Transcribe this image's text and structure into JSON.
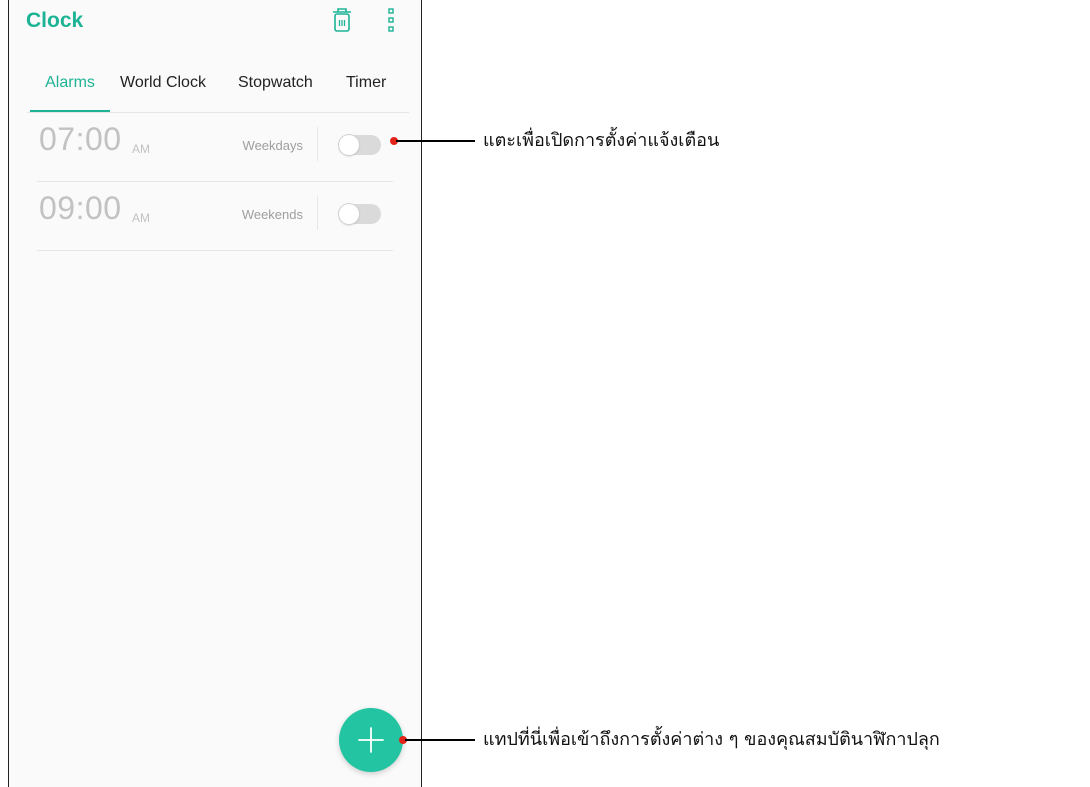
{
  "app": {
    "title": "Clock"
  },
  "toolbar": {
    "delete_icon": "trash-icon",
    "more_icon": "more-vertical-icon"
  },
  "tabs": [
    {
      "label": "Alarms",
      "active": true
    },
    {
      "label": "World Clock",
      "active": false
    },
    {
      "label": "Stopwatch",
      "active": false
    },
    {
      "label": "Timer",
      "active": false
    }
  ],
  "alarms": [
    {
      "time": "07:00",
      "ampm": "AM",
      "repeat": "Weekdays",
      "enabled": false
    },
    {
      "time": "09:00",
      "ampm": "AM",
      "repeat": "Weekends",
      "enabled": false
    }
  ],
  "fab": {
    "icon": "plus-icon"
  },
  "callouts": {
    "toggle": "แตะเพื่อเปิดการตั้งค่าแจ้งเตือน",
    "fab": "แทปที่นี่เพื่อเข้าถึงการตั้งค่าต่าง ๆ ของคุณสมบัตินาฬิกาปลุก"
  },
  "colors": {
    "accent": "#1db394",
    "fab": "#22c4a2",
    "callout_dot": "#e2231a",
    "toggle_off": "#dadada",
    "time_text": "#c2c2c2"
  }
}
